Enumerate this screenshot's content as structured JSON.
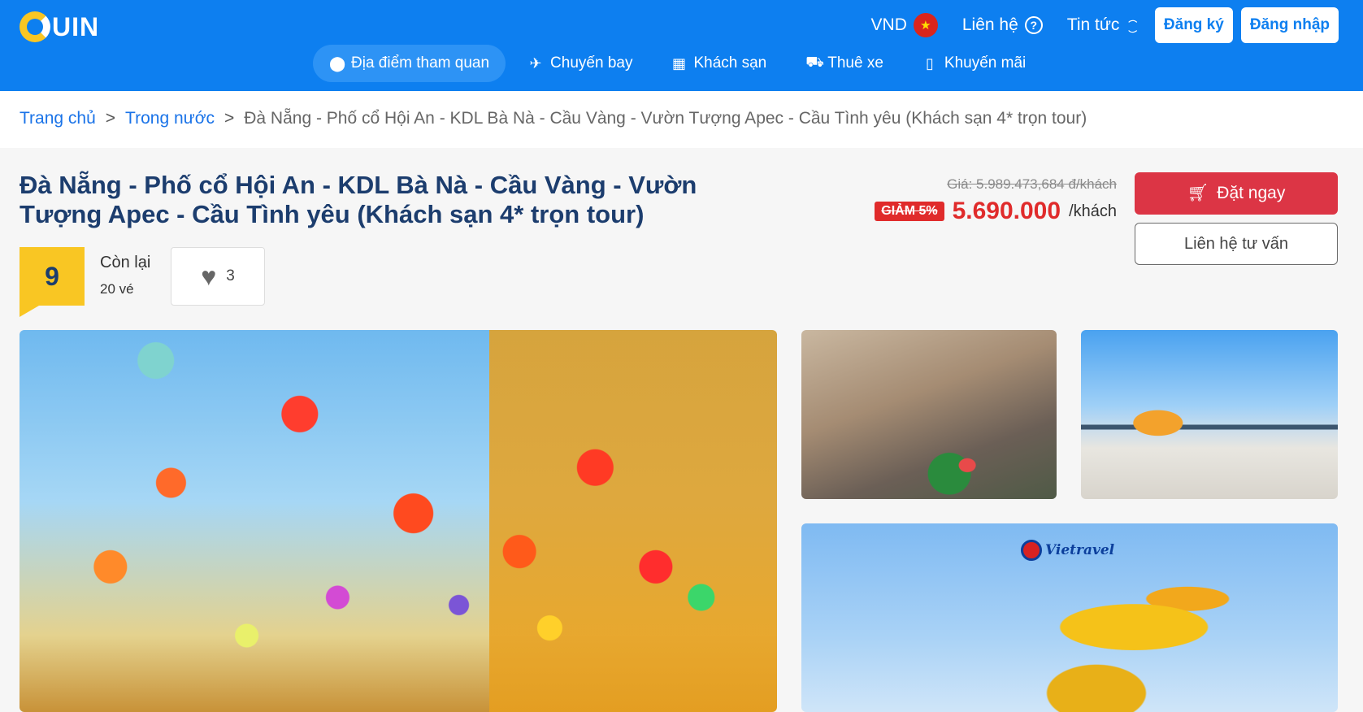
{
  "header": {
    "logo_text": "UIN",
    "currency": "VND",
    "contact_label": "Liên hệ",
    "news_label": "Tin tức",
    "register_label": "Đăng ký",
    "login_label": "Đăng nhập",
    "brand_color": "#0d7ff0",
    "nav": [
      {
        "label": "Địa điểm tham quan",
        "icon": "location-pin-icon",
        "active": true
      },
      {
        "label": "Chuyến bay",
        "icon": "airplane-icon"
      },
      {
        "label": "Khách sạn",
        "icon": "hotel-icon"
      },
      {
        "label": "Thuê xe",
        "icon": "car-icon"
      },
      {
        "label": "Khuyến mãi",
        "icon": "bookmark-icon"
      }
    ]
  },
  "breadcrumb": {
    "home": "Trang chủ",
    "category": "Trong nước",
    "current": "Đà Nẵng - Phố cổ Hội An - KDL Bà Nà - Cầu Vàng - Vườn Tượng Apec - Cầu Tình yêu (Khách sạn 4* trọn tour)",
    "separator": ">"
  },
  "tour": {
    "title": "Đà Nẵng - Phố cổ Hội An - KDL Bà Nà - Cầu Vàng - Vườn Tượng Apec - Cầu Tình yêu (Khách sạn 4* trọn tour)",
    "old_price": "Giá: 5.989.473,684 đ/khách",
    "discount": "GIẢM 5%",
    "price": "5.690.000",
    "per_unit": "/khách",
    "book_label": "Đặt ngay",
    "consult_label": "Liên hệ tư vấn",
    "score": "9",
    "remaining_label": "Còn lại",
    "remaining_count": "20 vé",
    "likes": "3",
    "price_color": "#e02b2b",
    "score_color": "#f9c623"
  },
  "gallery": {
    "watermark": "Vietravel"
  }
}
